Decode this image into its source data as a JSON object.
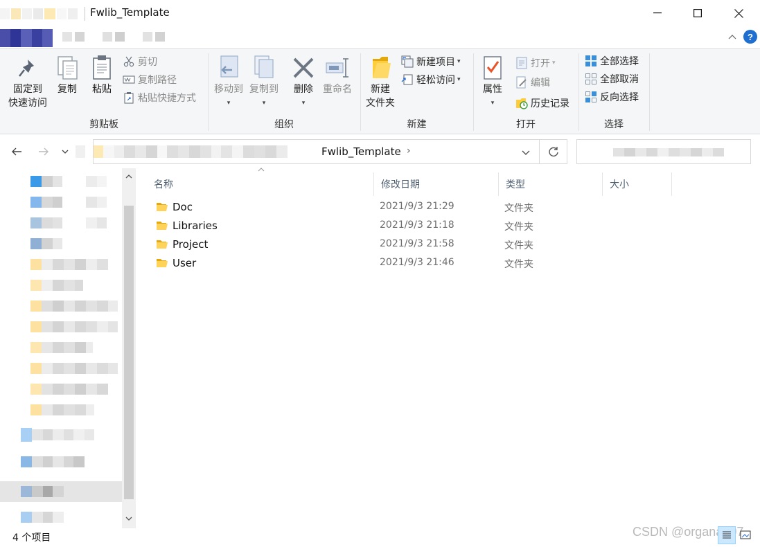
{
  "window": {
    "title": "Fwlib_Template"
  },
  "ribbon": {
    "groups": {
      "clipboard": {
        "label": "剪贴板",
        "pin_line1": "固定到",
        "pin_line2": "快速访问",
        "copy": "复制",
        "paste": "粘贴",
        "cut": "剪切",
        "copy_path": "复制路径",
        "paste_shortcut": "粘贴快捷方式"
      },
      "organize": {
        "label": "组织",
        "move_to": "移动到",
        "copy_to": "复制到",
        "delete": "删除",
        "rename": "重命名"
      },
      "new": {
        "label": "新建",
        "new_folder_line1": "新建",
        "new_folder_line2": "文件夹",
        "new_item": "新建项目",
        "easy_access": "轻松访问"
      },
      "open": {
        "label": "打开",
        "properties": "属性",
        "open": "打开",
        "edit": "编辑",
        "history": "历史记录"
      },
      "select": {
        "label": "选择",
        "select_all": "全部选择",
        "select_none": "全部取消",
        "invert": "反向选择"
      }
    }
  },
  "address": {
    "current_folder": "Fwlib_Template"
  },
  "file_list": {
    "columns": [
      "名称",
      "修改日期",
      "类型",
      "大小"
    ],
    "rows": [
      {
        "name": "Doc",
        "modified": "2021/9/3 21:29",
        "type": "文件夹"
      },
      {
        "name": "Libraries",
        "modified": "2021/9/3 21:18",
        "type": "文件夹"
      },
      {
        "name": "Project",
        "modified": "2021/9/3 21:58",
        "type": "文件夹"
      },
      {
        "name": "User",
        "modified": "2021/9/3 21:46",
        "type": "文件夹"
      }
    ]
  },
  "status": {
    "item_count": "4 个项目"
  },
  "watermark": "CSDN @organa007",
  "colors": {
    "folder_yellow": "#ffd35a",
    "accent_blue": "#1e6fd0",
    "ribbon_bg": "#f5f6f7",
    "selection_bg": "#e5e5e5"
  }
}
